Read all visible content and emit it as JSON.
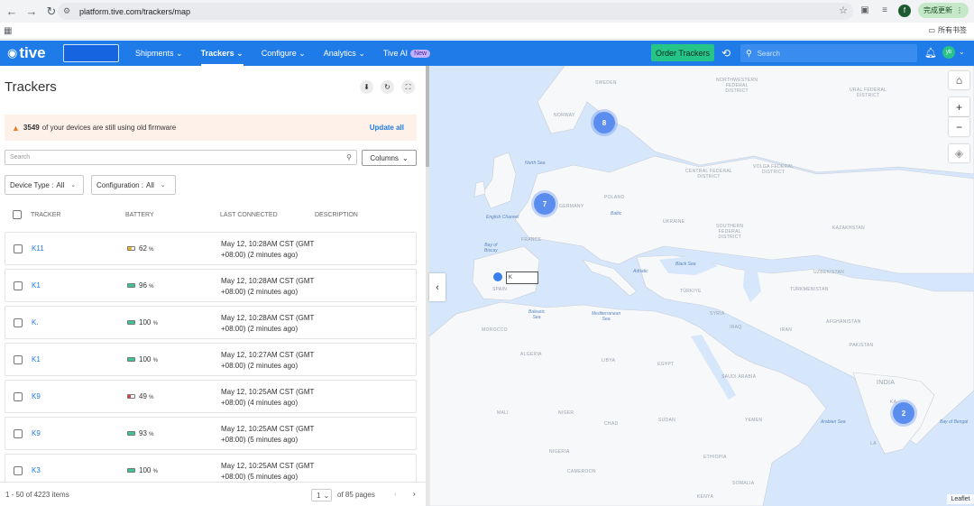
{
  "browser": {
    "url": "platform.tive.com/trackers/map",
    "update_label": "完成更新",
    "profile_initial": "f",
    "all_bookmarks": "所有书签"
  },
  "header": {
    "logo_text": "tive",
    "nav": [
      {
        "label": "Shipments",
        "active": false
      },
      {
        "label": "Trackers",
        "active": true
      },
      {
        "label": "Configure",
        "active": false
      },
      {
        "label": "Analytics",
        "active": false
      },
      {
        "label": "Tive AI",
        "active": false,
        "badge": "New"
      }
    ],
    "order_button": "Order Trackers",
    "search_placeholder": "Search",
    "user_initials": "yb"
  },
  "panel": {
    "title": "Trackers",
    "alert": {
      "count": "3549",
      "message": "of your devices are still using old firmware",
      "action": "Update all"
    },
    "search_placeholder": "Search",
    "columns_button": "Columns",
    "filters": [
      {
        "label": "Device Type :",
        "value": "All"
      },
      {
        "label": "Configuration :",
        "value": "All"
      }
    ],
    "columns": [
      "TRACKER",
      "BATTERY",
      "LAST CONNECTED",
      "DESCRIPTION"
    ],
    "rows": [
      {
        "tracker": "K11",
        "battery": "62",
        "battery_level": 0.62,
        "battery_color": "#f0b429",
        "last1": "May 12, 10:28AM CST (GMT",
        "last2": "+08:00) (2 minutes ago)"
      },
      {
        "tracker": "K1",
        "battery": "96",
        "battery_level": 0.96,
        "battery_color": "#3cc39b",
        "last1": "May 12, 10:28AM CST (GMT",
        "last2": "+08:00) (2 minutes ago)"
      },
      {
        "tracker": "K.",
        "battery": "100",
        "battery_level": 1.0,
        "battery_color": "#3cc39b",
        "last1": "May 12, 10:28AM CST (GMT",
        "last2": "+08:00) (2 minutes ago)"
      },
      {
        "tracker": "K1",
        "battery": "100",
        "battery_level": 1.0,
        "battery_color": "#3cc39b",
        "last1": "May 12, 10:27AM CST (GMT",
        "last2": "+08:00) (2 minutes ago)"
      },
      {
        "tracker": "K9",
        "battery": "49",
        "battery_level": 0.49,
        "battery_color": "#e53e3e",
        "last1": "May 12, 10:25AM CST (GMT",
        "last2": "+08:00) (4 minutes ago)"
      },
      {
        "tracker": "K9",
        "battery": "93",
        "battery_level": 0.93,
        "battery_color": "#3cc39b",
        "last1": "May 12, 10:25AM CST (GMT",
        "last2": "+08:00) (5 minutes ago)"
      },
      {
        "tracker": "K3",
        "battery": "100",
        "battery_level": 1.0,
        "battery_color": "#3cc39b",
        "last1": "May 12, 10:25AM CST (GMT",
        "last2": "+08:00) (5 minutes ago)"
      }
    ],
    "pct_suffix": "%",
    "pager": {
      "items": "1 - 50 of 4223 items",
      "page": "1",
      "of_pages": "of 85 pages"
    }
  },
  "map": {
    "clusters": [
      {
        "count": "8"
      },
      {
        "count": "7"
      },
      {
        "count": "2"
      }
    ],
    "pin_label": "K",
    "attribution": "Leaflet",
    "labels": {
      "sweden": "SWEDEN",
      "norway": "NORWAY",
      "nw_district": "NORTHWESTERN\nFEDERAL\nDISTRICT",
      "ural": "URAL FEDERAL\nDISTRICT",
      "central": "CENTRAL FEDERAL\nDISTRICT",
      "volga": "VOLGA FEDERAL\nDISTRICT",
      "poland": "POLAND",
      "germany": "GERMANY",
      "ukraine": "UKRAINE",
      "southern": "SOUTHERN\nFEDERAL\nDISTRICT",
      "france": "FRANCE",
      "kazakhstan": "KAZAKHSTAN",
      "spain": "SPAIN",
      "uzbekistan": "UZBEKISTAN",
      "turkiye": "TÜRKIYE",
      "turkmenistan": "TURKMENISTAN",
      "afghanistan": "AFGHANISTAN",
      "morocco": "MOROCCO",
      "syria": "SYRIA",
      "iraq": "IRAQ",
      "iran": "IRAN",
      "pakistan": "PAKISTAN",
      "algeria": "ALGERIA",
      "libya": "LIBYA",
      "egypt": "EGYPT",
      "saudi": "SAUDI ARABIA",
      "india": "INDIA",
      "mali": "MALI",
      "niger": "NIGER",
      "chad": "CHAD",
      "sudan": "SUDAN",
      "yemen": "YEMEN",
      "nigeria": "NIGERIA",
      "ethiopia": "ETHIOPIA",
      "cameroon": "CAMEROON",
      "somalia": "SOMALIA",
      "kenya": "KENYA",
      "ka": "KA",
      "la": "LA"
    },
    "seas": {
      "north_sea": "North Sea",
      "english_channel": "English Channel",
      "bay_biscay": "Bay of\nBiscay",
      "balearic": "Balearic\nSea",
      "black_sea": "Black Sea",
      "mediterranean": "Mediterranean\nSea",
      "arabian": "Arabian Sea",
      "bengal": "Bay of Bengal",
      "adriatic": "Adriatic",
      "baltic": "Baltic"
    }
  }
}
